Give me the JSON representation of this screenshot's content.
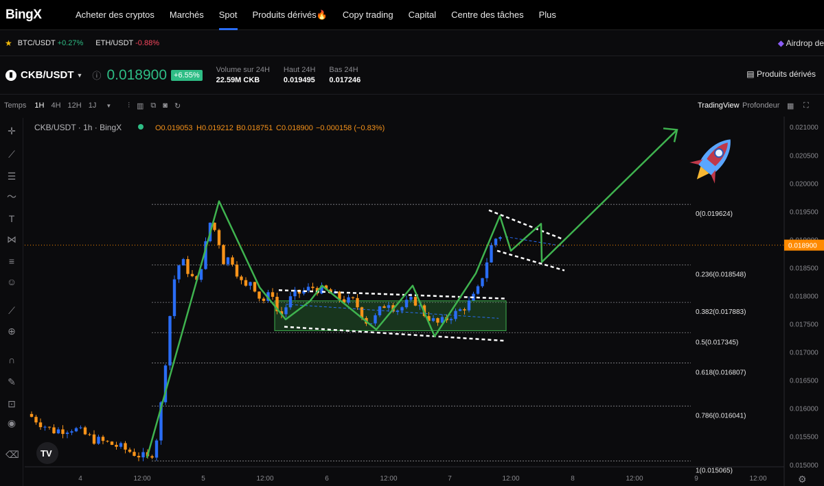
{
  "nav": {
    "logo": "BingX",
    "items": [
      "Acheter des cryptos",
      "Marchés",
      "Spot",
      "Produits dérivés🔥",
      "Copy trading",
      "Capital",
      "Centre des tâches",
      "Plus"
    ],
    "active_index": 2
  },
  "ticker": {
    "items": [
      {
        "pair": "BTC/USDT",
        "change": "+0.27%",
        "dir": "up"
      },
      {
        "pair": "ETH/USDT",
        "change": "-0.88%",
        "dir": "down"
      }
    ],
    "airdrop": "Airdrop de"
  },
  "header": {
    "pair": "CKB/USDT",
    "price": "0.018900",
    "change": "+6.55%",
    "stats": [
      {
        "label": "Volume sur 24H",
        "value": "22.59M CKB"
      },
      {
        "label": "Haut 24H",
        "value": "0.019495"
      },
      {
        "label": "Bas 24H",
        "value": "0.017246"
      }
    ],
    "derivatives": "Produits dérivés"
  },
  "toolbar": {
    "time_label": "Temps",
    "intervals": [
      "1H",
      "4H",
      "12H",
      "1J"
    ],
    "selected_interval": "1H",
    "tradingview": "TradingView",
    "depth": "Profondeur"
  },
  "chart_data": {
    "type": "candlestick",
    "legend_title": "CKB/USDT · 1h · BingX",
    "ohlc": {
      "o": "O0.019053",
      "h": "H0.019212",
      "l": "B0.018751",
      "c": "C0.018900",
      "chg": "−0.000158 (−0.83%)"
    },
    "y_ticks": [
      "0.021000",
      "0.020500",
      "0.020000",
      "0.019500",
      "0.019000",
      "0.018500",
      "0.018000",
      "0.017500",
      "0.017000",
      "0.016500",
      "0.016000",
      "0.015500",
      "0.015000"
    ],
    "y_range": [
      0.0149,
      0.0211
    ],
    "current_price": "0.018900",
    "current_value": 0.0189,
    "x_ticks": [
      "4",
      "12:00",
      "5",
      "12:00",
      "6",
      "12:00",
      "7",
      "12:00",
      "8",
      "12:00",
      "9",
      "12:00"
    ],
    "fib_levels": [
      {
        "label": "0(0.019624)",
        "value": 0.019624
      },
      {
        "label": "0.236(0.018548)",
        "value": 0.018548
      },
      {
        "label": "0.382(0.017883)",
        "value": 0.017883
      },
      {
        "label": "0.5(0.017345)",
        "value": 0.017345
      },
      {
        "label": "0.618(0.016807)",
        "value": 0.016807
      },
      {
        "label": "0.786(0.016041)",
        "value": 0.016041
      },
      {
        "label": "1(0.015065)",
        "value": 0.015065
      }
    ],
    "colors": {
      "up": "#2a6df5",
      "down": "#f7931a",
      "zigzag": "#3fb34f",
      "channel": "#ffffff",
      "price": "#ff8a00"
    }
  }
}
